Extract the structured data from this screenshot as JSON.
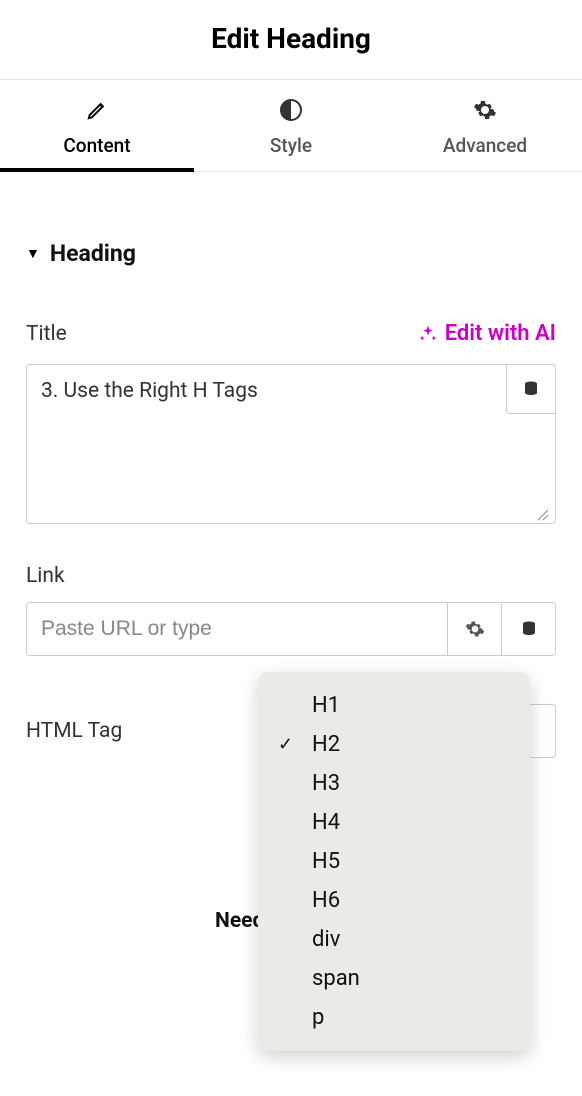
{
  "panel_title": "Edit Heading",
  "tabs": [
    {
      "label": "Content",
      "icon": "pencil",
      "active": true
    },
    {
      "label": "Style",
      "icon": "contrast",
      "active": false
    },
    {
      "label": "Advanced",
      "icon": "gear",
      "active": false
    }
  ],
  "section": {
    "title": "Heading"
  },
  "title_field": {
    "label": "Title",
    "ai_label": "Edit with AI",
    "value": "3. Use the Right H Tags"
  },
  "link_field": {
    "label": "Link",
    "placeholder": "Paste URL or type",
    "value": ""
  },
  "html_tag_field": {
    "label": "HTML Tag",
    "selected": "H2",
    "options": [
      "H1",
      "H2",
      "H3",
      "H4",
      "H5",
      "H6",
      "div",
      "span",
      "p"
    ]
  },
  "need_text": "Need"
}
